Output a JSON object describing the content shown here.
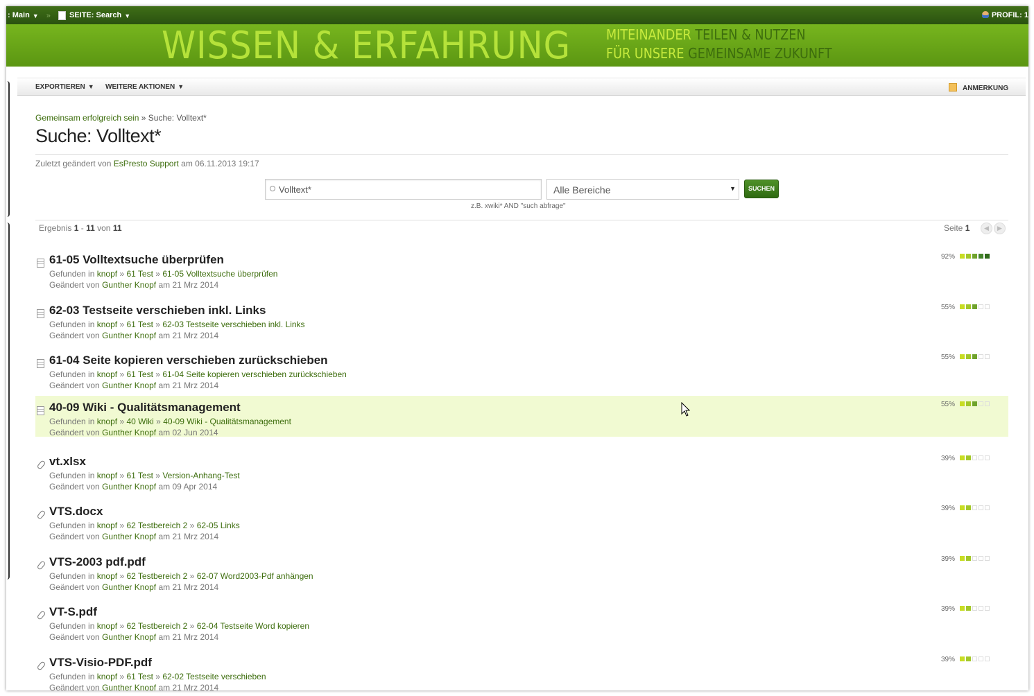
{
  "topbar": {
    "space_prefix": ":",
    "space_label": "Main",
    "separator": "»",
    "page_prefix": "SEITE:",
    "page_label": "Search",
    "profile_label": "PROFIL:",
    "profile_value": "1",
    "colors": {
      "bar": "#2f5a12",
      "text": "#ffffff"
    }
  },
  "banner": {
    "headline": "WISSEN & ERFAHRUNG",
    "line1_a": "MITEINANDER",
    "line1_b": "TEILEN & NUTZEN",
    "line2_a": "FÜR UNSERE",
    "line2_b": "GEMEINSAME ZUKUNFT",
    "colors": {
      "background": "#6aa618",
      "headline": "#b5e23a",
      "accent": "#3d6d0d"
    }
  },
  "toolbar": {
    "export": "EXPORTIEREN",
    "more_actions": "WEITERE AKTIONEN",
    "comment": "ANMERKUNG"
  },
  "breadcrumb": {
    "home": "Gemeinsam erfolgreich sein",
    "sep": "»",
    "current": "Suche: Volltext*"
  },
  "page_title": "Suche: Volltext*",
  "meta": {
    "prefix": "Zuletzt geändert von",
    "author": "EsPresto Support",
    "on": "am",
    "date": "06.11.2013 19:17"
  },
  "search": {
    "value": "Volltext*",
    "scope": "Alle Bereiche",
    "button": "SUCHEN",
    "hint": "z.B. xwiki* AND \"such abfrage\""
  },
  "results_header": {
    "label": "Ergebnis",
    "from": "1",
    "dash": "-",
    "to": "11",
    "of": "von",
    "total": "11",
    "page_label": "Seite",
    "page": "1"
  },
  "labels": {
    "found_in": "Gefunden in",
    "changed_by": "Geändert von",
    "on": "am",
    "crumb_sep": "»"
  },
  "results": [
    {
      "type": "doc",
      "title": "61-05 Volltextsuche überprüfen",
      "path": [
        "knopf",
        "61 Test",
        "61-05 Volltextsuche überprüfen"
      ],
      "author": "Gunther Knopf",
      "date": "21 Mrz 2014",
      "score": "92%",
      "level": 5,
      "highlighted": false
    },
    {
      "type": "doc",
      "title": "62-03 Testseite verschieben inkl. Links",
      "path": [
        "knopf",
        "61 Test",
        "62-03 Testseite verschieben inkl. Links"
      ],
      "author": "Gunther Knopf",
      "date": "21 Mrz 2014",
      "score": "55%",
      "level": 3,
      "highlighted": false
    },
    {
      "type": "doc",
      "title": "61-04 Seite kopieren verschieben zurückschieben",
      "path": [
        "knopf",
        "61 Test",
        "61-04 Seite kopieren verschieben zurückschieben"
      ],
      "author": "Gunther Knopf",
      "date": "21 Mrz 2014",
      "score": "55%",
      "level": 3,
      "highlighted": false
    },
    {
      "type": "doc",
      "title": "40-09 Wiki - Qualitätsmanagement",
      "path": [
        "knopf",
        "40 Wiki",
        "40-09 Wiki - Qualitätsmanagement"
      ],
      "author": "Gunther Knopf",
      "date": "02 Jun 2014",
      "score": "55%",
      "level": 3,
      "highlighted": true
    },
    {
      "type": "attachment",
      "title": "vt.xlsx",
      "path": [
        "knopf",
        "61 Test",
        "Version-Anhang-Test"
      ],
      "author": "Gunther Knopf",
      "date": "09 Apr 2014",
      "score": "39%",
      "level": 2,
      "highlighted": false
    },
    {
      "type": "attachment",
      "title": "VTS.docx",
      "path": [
        "knopf",
        "62 Testbereich 2",
        "62-05 Links"
      ],
      "author": "Gunther Knopf",
      "date": "21 Mrz 2014",
      "score": "39%",
      "level": 2,
      "highlighted": false
    },
    {
      "type": "attachment",
      "title": "VTS-2003 pdf.pdf",
      "path": [
        "knopf",
        "62 Testbereich 2",
        "62-07 Word2003-Pdf anhängen"
      ],
      "author": "Gunther Knopf",
      "date": "21 Mrz 2014",
      "score": "39%",
      "level": 2,
      "highlighted": false
    },
    {
      "type": "attachment",
      "title": "VT-S.pdf",
      "path": [
        "knopf",
        "62 Testbereich 2",
        "62-04 Testseite Word kopieren"
      ],
      "author": "Gunther Knopf",
      "date": "21 Mrz 2014",
      "score": "39%",
      "level": 2,
      "highlighted": false
    },
    {
      "type": "attachment",
      "title": "VTS-Visio-PDF.pdf",
      "path": [
        "knopf",
        "61 Test",
        "62-02 Testseite verschieben"
      ],
      "author": "Gunther Knopf",
      "date": "21 Mrz 2014",
      "score": "39%",
      "level": 2,
      "highlighted": false
    }
  ]
}
